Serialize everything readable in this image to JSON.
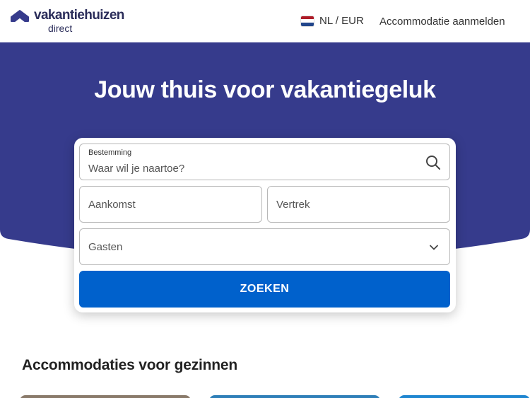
{
  "header": {
    "brand_name": "vakantiehuizen",
    "brand_sub": "direct",
    "locale": "NL / EUR",
    "host_link": "Accommodatie aanmelden"
  },
  "hero": {
    "title": "Jouw thuis voor vakantiegeluk",
    "background_color": "#363b8c"
  },
  "search": {
    "destination_label": "Bestemming",
    "destination_placeholder": "Waar wil je naartoe?",
    "arrival_placeholder": "Aankomst",
    "departure_placeholder": "Vertrek",
    "guests_placeholder": "Gasten",
    "submit_label": "ZOEKEN",
    "button_color": "#0061cc"
  },
  "section": {
    "title": "Accommodaties voor gezinnen"
  },
  "icons": {
    "brand": "house-roof-icon",
    "flag": "netherlands-flag-icon",
    "search": "search-icon",
    "dropdown": "chevron-down-icon"
  }
}
